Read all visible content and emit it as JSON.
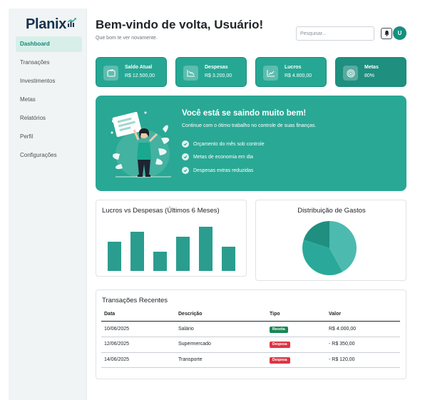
{
  "brand": {
    "name": "Planix"
  },
  "sidebar": {
    "items": [
      {
        "label": "Dashboard",
        "active": true
      },
      {
        "label": "Transações",
        "active": false
      },
      {
        "label": "Investimentos",
        "active": false
      },
      {
        "label": "Metas",
        "active": false
      },
      {
        "label": "Relatórios",
        "active": false
      },
      {
        "label": "Perfil",
        "active": false
      },
      {
        "label": "Configurações",
        "active": false
      }
    ]
  },
  "header": {
    "title": "Bem-vindo de volta, Usuário!",
    "subtitle": "Que bom te ver novamente.",
    "search_placeholder": "Pesquisar...",
    "avatar_initial": "U"
  },
  "stats": [
    {
      "label": "Saldo Atual",
      "value": "R$ 12.500,00",
      "icon": "wallet-icon"
    },
    {
      "label": "Despesas",
      "value": "R$ 3.200,00",
      "icon": "chart-down-icon"
    },
    {
      "label": "Lucros",
      "value": "R$ 4.800,00",
      "icon": "chart-up-icon"
    },
    {
      "label": "Metas",
      "value": "80%",
      "icon": "target-icon"
    }
  ],
  "banner": {
    "title": "Você está se saindo muito bem!",
    "text": "Continue com o ótimo trabalho no controle de suas finanças.",
    "bullets": [
      "Orçamento do mês sob controle",
      "Metas de economia em dia",
      "Despesas extras reduzidas"
    ]
  },
  "charts": {
    "bar_title": "Lucros vs Despesas (Últimos 6 Meses)",
    "pie_title": "Distribuição de Gastos"
  },
  "chart_data": [
    {
      "type": "bar",
      "title": "Lucros vs Despesas (Últimos 6 Meses)",
      "values": [
        41,
        55,
        27,
        48,
        62,
        34
      ],
      "ylim": [
        0,
        70
      ],
      "color": "#2a9d8f"
    },
    {
      "type": "pie",
      "title": "Distribuição de Gastos",
      "values": [
        42,
        38,
        20
      ],
      "colors": [
        "#4dbab0",
        "#2aa99a",
        "#1f8f80"
      ]
    }
  ],
  "transactions": {
    "title": "Transações Recentes",
    "columns": [
      "Data",
      "Descrição",
      "Tipo",
      "Valor"
    ],
    "rows": [
      {
        "date": "10/06/2025",
        "desc": "Salário",
        "type": "Receita",
        "value": "R$ 4.000,00"
      },
      {
        "date": "12/06/2025",
        "desc": "Supermercado",
        "type": "Despesa",
        "value": "- R$ 350,00"
      },
      {
        "date": "14/06/2025",
        "desc": "Transporte",
        "type": "Despesa",
        "value": "- R$ 120,00"
      }
    ]
  },
  "colors": {
    "accent": "#26a794",
    "income": "#198754",
    "expense": "#dc3545"
  }
}
